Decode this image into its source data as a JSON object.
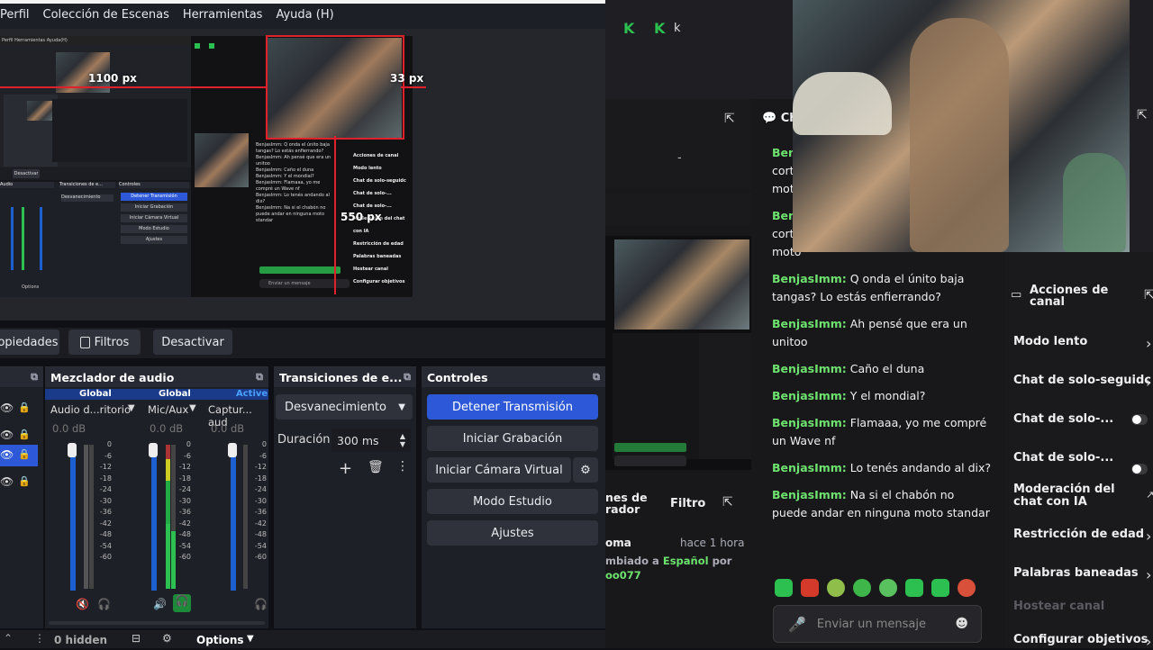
{
  "menu": [
    "Perfil",
    "Colección de Escenas",
    "Herramientas",
    "Ayuda (H)"
  ],
  "preview": {
    "label_width": "1100 px",
    "label_right": "33 px",
    "label_height": "550 px"
  },
  "source_tabs": {
    "properties": "opiedades",
    "filters": "Filtros",
    "disable": "Desactivar"
  },
  "audio_mixer": {
    "title": "Mezclador de audio",
    "channels": [
      {
        "tag": "Global",
        "name": "Audio d...ritorio",
        "db": "0.0 dB"
      },
      {
        "tag": "Global",
        "name": "Mic/Aux",
        "db": "0.0 dB"
      },
      {
        "tag": "Active",
        "name": "Captur... aud",
        "db": "0.0 dB"
      }
    ],
    "scale": [
      "0",
      "-6",
      "-12",
      "-18",
      "-24",
      "-30",
      "-36",
      "-42",
      "-48",
      "-54",
      "-60"
    ]
  },
  "transitions": {
    "title": "Transiciones de e...",
    "selected": "Desvanecimiento",
    "duration_label": "Duración",
    "duration_value": "300 ms"
  },
  "controls": {
    "title": "Controles",
    "buttons": [
      "Detener Transmisión",
      "Iniciar Grabación",
      "Iniciar Cámara Virtual",
      "Modo Estudio",
      "Ajustes"
    ]
  },
  "footer": {
    "hidden": "0 hidden",
    "options": "Options"
  },
  "twitch": {
    "top_letter": "k",
    "chat_title": "Ch",
    "left_panel": {
      "dash": "-",
      "actions_title": "nes de\nrador",
      "filter": "Filtro",
      "activity_name": "oma",
      "activity_time": "hace 1 hora",
      "activity_text_a": "mbiado a",
      "activity_lang": "Español",
      "activity_text_b": "por",
      "activity_user": "oo077"
    },
    "partial_lines": [
      "Benj",
      "cort",
      "mot",
      "Benj",
      "cort",
      "moto"
    ],
    "messages": [
      {
        "user": "BenjasImm:",
        "text": "Q onda el únito baja tangas? Lo estás enfierrando?"
      },
      {
        "user": "BenjasImm:",
        "text": "Ah pensé que era un unitoo"
      },
      {
        "user": "BenjasImm:",
        "text": "Caño el duna"
      },
      {
        "user": "BenjasImm:",
        "text": "Y el mondial?"
      },
      {
        "user": "BenjasImm:",
        "text": "Flamaaa, yo me compré un Wave nf"
      },
      {
        "user": "BenjasImm:",
        "text": "Lo tenés andando al dix?"
      },
      {
        "user": "BenjasImm:",
        "text": "Na si el chabón no puede andar en ninguna moto standar"
      }
    ],
    "chat_placeholder": "Enviar un mensaje",
    "channel_actions": {
      "title": "Acciones de canal",
      "items": [
        {
          "label": "Modo lento",
          "control": "arrow"
        },
        {
          "label": "Chat de solo-seguidc",
          "control": "arrow"
        },
        {
          "label": "Chat de solo-...",
          "control": "toggle"
        },
        {
          "label": "Chat de solo-...",
          "control": "toggle"
        },
        {
          "label": "Moderación del chat con IA",
          "control": "link"
        },
        {
          "label": "Restricción de edad",
          "control": "arrow"
        },
        {
          "label": "Palabras baneadas",
          "control": "arrow"
        },
        {
          "label": "Hostear canal",
          "control": "none"
        },
        {
          "label": "Configurar objetivos",
          "control": "arrow"
        }
      ]
    }
  },
  "mini": {
    "chat": [
      "BenjasImm: Q onda el únito baja tangas? Lo estás enfierrando?",
      "BenjasImm: Ah pensé que era un unitoo",
      "BenjasImm: Caño el duna",
      "BenjasImm: Y el mondial?",
      "BenjasImm: Flamaaa, yo me compré un Wave nf",
      "BenjasImm: Lo tenés andando al dix?",
      "BenjasImm: Na si el chabón no puede andar en ninguna moto standar"
    ],
    "actions": [
      "Acciones de canal",
      "Modo lento",
      "Chat de solo-seguidc",
      "Chat de solo-...",
      "Chat de solo-...",
      "Moderación del chat con IA",
      "Restricción de edad",
      "Palabras baneadas",
      "Hostear canal",
      "Configurar objetivos"
    ],
    "placeholder": "Enviar un mensaje",
    "obs_controls": [
      "Detener Transmisión",
      "Iniciar Grabación",
      "Iniciar Cámara Virtual",
      "Modo Estudio",
      "Ajustes"
    ],
    "obs_menu": "Perfil  Herramientas  Ayuda(H)",
    "obs_heads": [
      "Audio",
      "Transiciones de e...",
      "Controles"
    ],
    "deactivate": "Desactivar",
    "fade": "Desvanecimiento",
    "options": "Options"
  }
}
